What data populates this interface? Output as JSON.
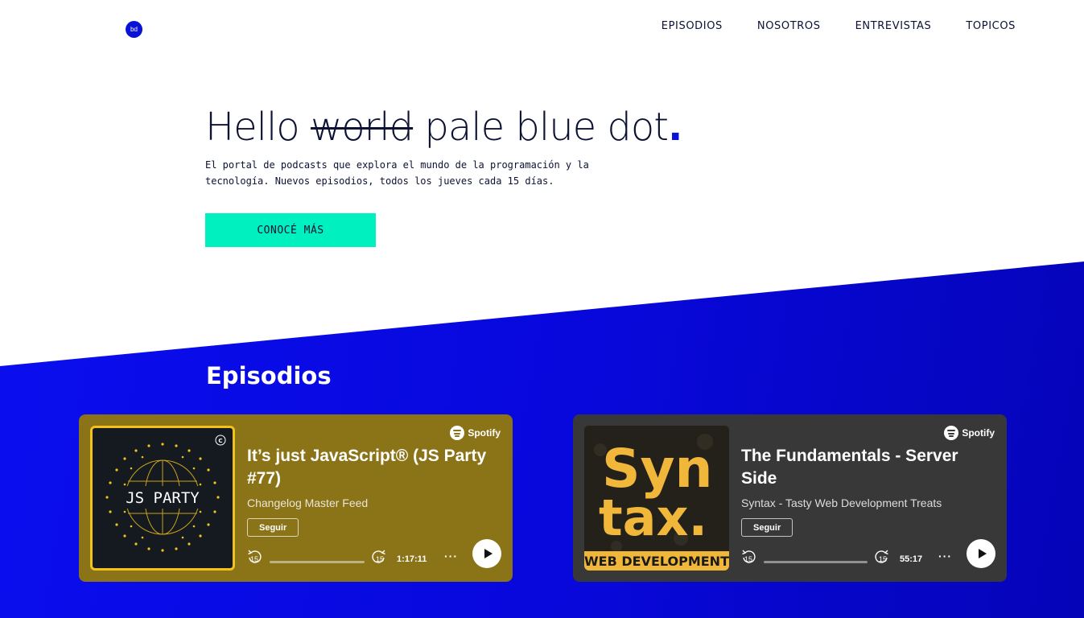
{
  "brand": {
    "logo_text": "bd"
  },
  "nav": [
    "EPISODIOS",
    "NOSOTROS",
    "ENTREVISTAS",
    "TOPICOS"
  ],
  "hero": {
    "title_start": "Hello",
    "title_strike": "world",
    "title_end": "pale blue dot",
    "title_dot": ".",
    "subtitle_line1": "El portal de podcasts que explora el mundo de la programación y la",
    "subtitle_line2": "tecnología. Nuevos episodios, todos los jueves cada 15 días.",
    "cta_label": "CONOCÉ MÁS"
  },
  "episodes_section": {
    "title": "Episodios",
    "cards": [
      {
        "title": "It’s just JavaScript® (JS Party #77)",
        "show": "Changelog Master Feed",
        "follow_label": "Seguir",
        "duration": "1:17:11",
        "spotify_label": "Spotify",
        "cover_text": "JS PARTY",
        "cover_badge": "C",
        "skip_label": "15",
        "more_label": "···",
        "bg_color": "#8b7318"
      },
      {
        "title": "The Fundamentals - Server Side",
        "show": "Syntax - Tasty Web Development Treats",
        "follow_label": "Seguir",
        "duration": "55:17",
        "spotify_label": "Spotify",
        "cover_line1": "Syn",
        "cover_line2": "tax.",
        "cover_banner": "WEB DEVELOPMENT",
        "skip_label": "15",
        "more_label": "···",
        "bg_color": "#383838"
      }
    ]
  },
  "colors": {
    "accent_blue": "#0a12d6",
    "cta_teal": "#00f0c0",
    "text_dark": "#0b1233"
  }
}
